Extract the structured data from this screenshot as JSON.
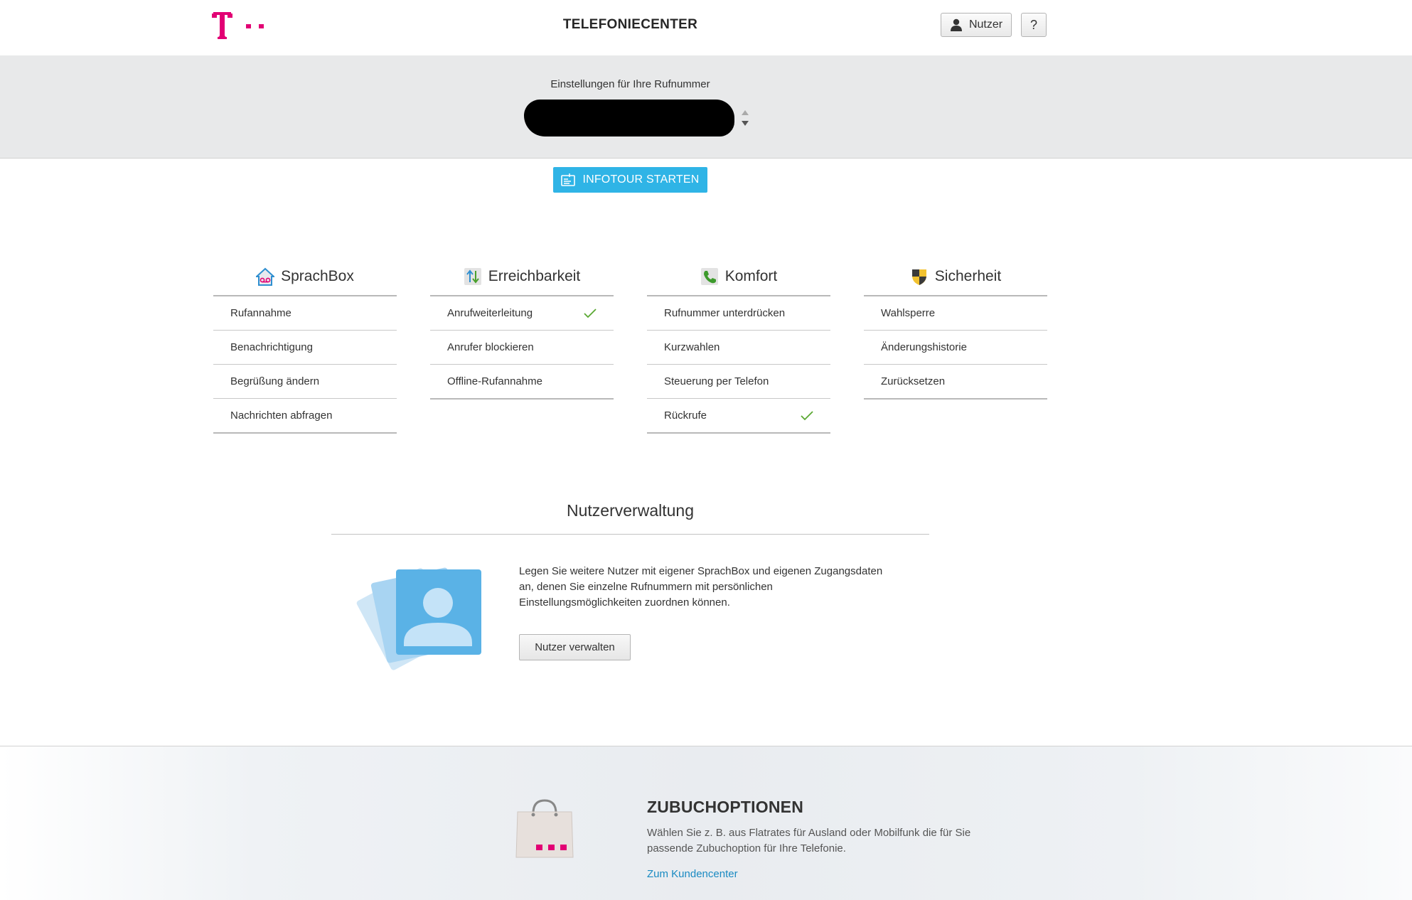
{
  "header": {
    "title": "TELEFONIECENTER",
    "user_label": "Nutzer",
    "help_label": "?",
    "brand_color": "#e20074"
  },
  "number_selector": {
    "label": "Einstellungen für Ihre Rufnummer"
  },
  "tour_button": {
    "label": "INFOTOUR STARTEN",
    "color": "#2fb4e6"
  },
  "columns": [
    {
      "title": "SprachBox",
      "icon": "voicemail-house-icon",
      "items": [
        {
          "label": "Rufannahme",
          "checked": false
        },
        {
          "label": "Benachrichtigung",
          "checked": false
        },
        {
          "label": "Begrüßung ändern",
          "checked": false
        },
        {
          "label": "Nachrichten abfragen",
          "checked": false
        }
      ]
    },
    {
      "title": "Erreichbarkeit",
      "icon": "call-arrows-icon",
      "items": [
        {
          "label": "Anrufweiterleitung",
          "checked": true
        },
        {
          "label": "Anrufer blockieren",
          "checked": false
        },
        {
          "label": "Offline-Rufannahme",
          "checked": false
        }
      ]
    },
    {
      "title": "Komfort",
      "icon": "phone-handset-icon",
      "items": [
        {
          "label": "Rufnummer unterdrücken",
          "checked": false
        },
        {
          "label": "Kurzwahlen",
          "checked": false
        },
        {
          "label": "Steuerung per Telefon",
          "checked": false
        },
        {
          "label": "Rückrufe",
          "checked": true
        }
      ]
    },
    {
      "title": "Sicherheit",
      "icon": "shield-icon",
      "items": [
        {
          "label": "Wahlsperre",
          "checked": false
        },
        {
          "label": "Änderungshistorie",
          "checked": false
        },
        {
          "label": "Zurücksetzen",
          "checked": false
        }
      ]
    }
  ],
  "user_management": {
    "title": "Nutzerverwaltung",
    "description": "Legen Sie weitere Nutzer mit eigener SprachBox und eigenen Zugangsdaten an, denen Sie einzelne Rufnummern mit persönlichen Einstellungsmöglichkeiten zuordnen können.",
    "button_label": "Nutzer verwalten"
  },
  "addons": {
    "title": "ZUBUCHOPTIONEN",
    "description": "Wählen Sie z. B. aus Flatrates für Ausland oder Mobilfunk die für Sie passende Zubuchoption für Ihre Telefonie.",
    "link_label": "Zum Kundencenter"
  }
}
